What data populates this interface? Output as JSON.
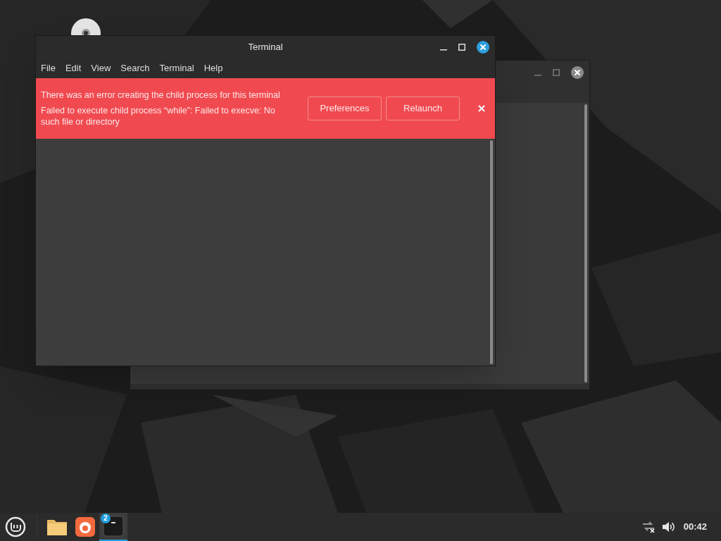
{
  "terminal_window": {
    "title": "Terminal",
    "menu": [
      "File",
      "Edit",
      "View",
      "Search",
      "Terminal",
      "Help"
    ],
    "error_banner": {
      "messages": [
        "There was an error creating the child process for this terminal",
        "Failed to execute child process “while”: Failed to execve: No such file or directory"
      ],
      "buttons": [
        "Preferences",
        "Relaunch"
      ]
    }
  },
  "taskbar": {
    "apps": [
      {
        "kind": "folder",
        "selected": false
      },
      {
        "kind": "browser",
        "selected": false
      },
      {
        "kind": "terminal",
        "selected": true,
        "badge": "2"
      }
    ],
    "clock": "00:42"
  }
}
